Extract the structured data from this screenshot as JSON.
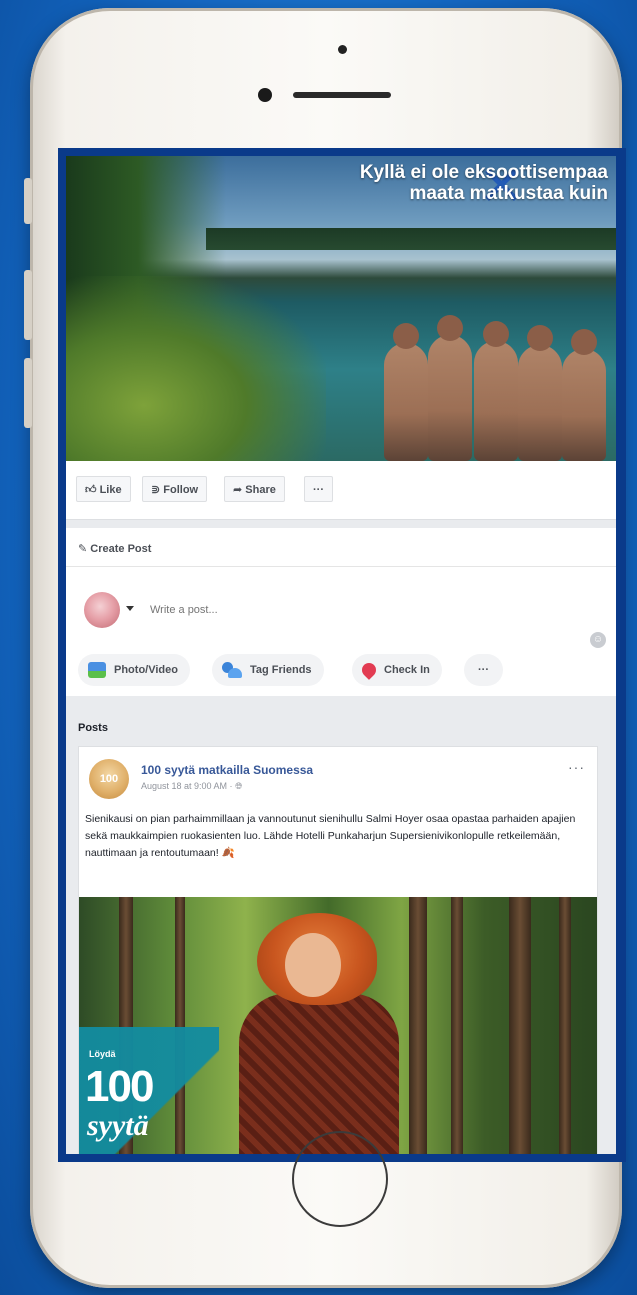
{
  "cover": {
    "title_line1": "Kyllä ei ole eksoottisempaa",
    "title_line2": "maata matkustaa kuin",
    "x_mark": "✕"
  },
  "actions": {
    "like": "Like",
    "follow": "Follow",
    "share": "Share",
    "more": "···"
  },
  "create_post": {
    "heading": "Create Post",
    "placeholder": "Write a post...",
    "photo_video": "Photo/Video",
    "tag_friends": "Tag Friends",
    "check_in": "Check In",
    "more": "···"
  },
  "posts": {
    "heading": "Posts",
    "items": [
      {
        "page_name": "100 syytä matkailla Suomessa",
        "avatar_text": "100",
        "meta": "August 18 at 9:00 AM · ",
        "text": "Sienikausi on pian parhaimmillaan ja vannoutunut sienihullu Salmi Hoyer osaa opastaa parhaiden apajien sekä maukkaimpien ruokasienten luo. Lähde Hotelli Punkaharjun Supersienivikonlopulle retkeilemään, nauttimaan ja rentoutumaan! 🍂",
        "more": "···",
        "badge_small": "Löydä",
        "badge_big": "100",
        "badge_word": "syytä"
      }
    ]
  }
}
